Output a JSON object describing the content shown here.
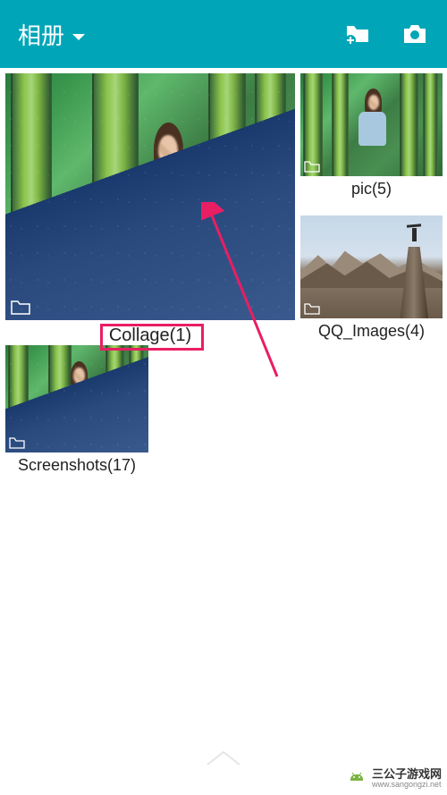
{
  "header": {
    "title": "相册",
    "icons": {
      "dropdown": "chevron-down",
      "new_folder": "add-folder",
      "camera": "camera"
    }
  },
  "albums": [
    {
      "name": "Collage",
      "count": 1,
      "label": "Collage(1)",
      "folder_icon": true,
      "highlighted": true
    },
    {
      "name": "pic",
      "count": 5,
      "label": "pic(5)",
      "folder_icon": true
    },
    {
      "name": "QQ_Images",
      "count": 4,
      "label": "QQ_Images(4)",
      "folder_icon": true
    },
    {
      "name": "Screenshots",
      "count": 17,
      "label": "Screenshots(17)",
      "folder_icon": true
    }
  ],
  "annotations": {
    "highlight_album": "Collage(1)",
    "arrow_color": "#e91e63"
  },
  "footer": {
    "brand": "三公子游戏网",
    "url": "www.sangongzi.net"
  },
  "colors": {
    "header_bg": "#00a6b8",
    "highlight": "#e91e63"
  }
}
